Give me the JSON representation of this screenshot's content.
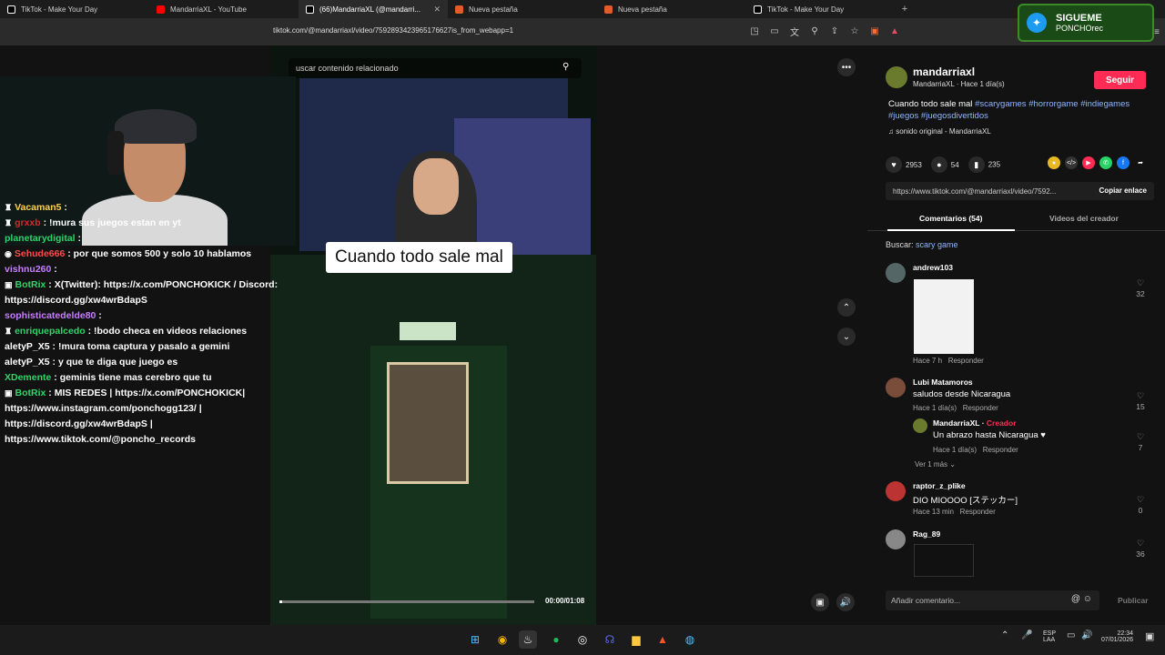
{
  "tabs": [
    {
      "label": "TikTok - Make Your Day",
      "color": "#111111"
    },
    {
      "label": "MandarriaXL - YouTube",
      "color": "#ff0000"
    },
    {
      "label": "(66)MandarriaXL (@mandarri...",
      "color": "#111111"
    },
    {
      "label": "Nueva pestaña",
      "color": "#e15b2b"
    },
    {
      "label": "Nueva pestaña",
      "color": "#e15b2b"
    },
    {
      "label": "TikTok - Make Your Day",
      "color": "#111111"
    }
  ],
  "address": {
    "url": "tiktok.com/@mandarriaxl/video/7592893423965176627is_from_webapp=1"
  },
  "overlay": {
    "follow_title": "SIGUEME",
    "follow_handle": "PONCHOrec"
  },
  "chat": [
    {
      "user": "Vacaman5",
      "color": "#ffd24d",
      "text": ":"
    },
    {
      "user": "grxxb",
      "color": "#d22b2b",
      "text": ": !mura sus juegos estan en yt"
    },
    {
      "user": "planetarydigital",
      "color": "#2bd46a",
      "text": ":"
    },
    {
      "user": "Sehude666",
      "color": "#ff4a4a",
      "text": ": por que somos 500 y solo 10 hablamos"
    },
    {
      "user": "vishnu260",
      "color": "#c77dff",
      "text": ":"
    },
    {
      "user": "BotRix",
      "color": "#2fd46b",
      "text": ": X(Twitter): https://x.com/PONCHOKICK / Discord: https://discord.gg/xw4wrBdapS"
    },
    {
      "user": "sophisticatedelde80",
      "color": "#c77dff",
      "text": ":"
    },
    {
      "user": "enriquepalcedo",
      "color": "#2fd46b",
      "text": ": !bodo checa en videos relaciones"
    },
    {
      "user": "aletyP_X5",
      "color": "#ffffff",
      "text": ": !mura toma captura y pasalo a gemini"
    },
    {
      "user": "aletyP_X5",
      "color": "#ffffff",
      "text": ": y que te diga que juego es"
    },
    {
      "user": "XDemente",
      "color": "#2fd46b",
      "text": ": geminis tiene mas cerebro que tu"
    },
    {
      "user": "BotRix",
      "color": "#2fd46b",
      "text": ": MIS REDES | https://x.com/PONCHOKICK| https://www.instagram.com/ponchogg123/ | https://discord.gg/xw4wrBdapS | https://www.tiktok.com/@poncho_records"
    }
  ],
  "video": {
    "search_placeholder": "uscar contenido relacionado",
    "caption": "Cuando todo sale mal",
    "time": "00:00/01:08",
    "progress": 0.01
  },
  "sidebar": {
    "author_name": "mandarriaxl",
    "author_sub": "MandarriaXL · Hace 1 día(s)",
    "follow_label": "Seguir",
    "desc_text": "Cuando todo sale mal",
    "tags": [
      "#scarygames",
      "#horrorgame",
      "#indiegames",
      "#juegos",
      "#juegosdivertidos"
    ],
    "sound": "sonido original - MandarriaXL",
    "likes": "2953",
    "comments": "54",
    "saves": "235",
    "link": "https://www.tiktok.com/@mandarriaxl/video/7592...",
    "copy_label": "Copiar enlace",
    "tab_comments": "Comentarios (54)",
    "tab_videos": "Videos del creador",
    "search_label": "Buscar:",
    "search_term": "scary game",
    "comment_placeholder": "Añadir comentario...",
    "publish_label": "Publicar"
  },
  "comments": [
    {
      "user": "andrew103",
      "text": "",
      "meta": "Hace 7 h",
      "reply": "Responder",
      "count": "32"
    },
    {
      "user": "Lubi Matamoros",
      "text": "saludos desde Nicaragua",
      "meta": "Hace 1 día(s)",
      "reply": "Responder",
      "count": "15"
    },
    {
      "user": "MandarriaXL",
      "creator": "Creador",
      "text": "Un abrazo hasta Nicaragua ♥",
      "meta": "Hace 1 día(s)",
      "reply": "Responder",
      "count": "7"
    },
    {
      "user": "raptor_z_plike",
      "text": "DIO MIOOOO [ステッカー]",
      "meta": "Hace 13 min",
      "reply": "Responder",
      "count": "0"
    },
    {
      "user": "Rag_89",
      "text": "",
      "meta": "",
      "reply": "",
      "count": "36"
    }
  ],
  "more_replies": "Ver 1 más",
  "system": {
    "lang": "ESP",
    "lang2": "LAA",
    "time": "22:34",
    "date": "07/01/2026"
  }
}
